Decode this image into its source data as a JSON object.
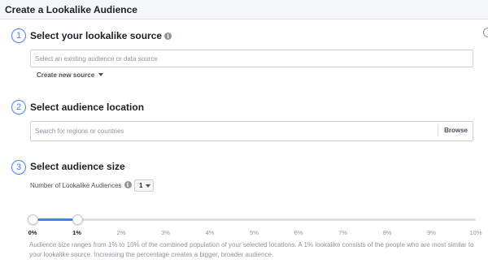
{
  "header": {
    "title": "Create a Lookalike Audience"
  },
  "steps": [
    {
      "number": "1",
      "title": "Select your lookalike source",
      "info_icon": "info-icon",
      "input_placeholder": "Select an existing audience or data source",
      "create_source_label": "Create new source"
    },
    {
      "number": "2",
      "title": "Select audience location",
      "input_placeholder": "Search for regions or countries",
      "browse_label": "Browse"
    },
    {
      "number": "3",
      "title": "Select audience size",
      "num_label": "Number of Lookalike Audiences",
      "num_value": "1"
    }
  ],
  "slider": {
    "range_percent": [
      0,
      1
    ],
    "ticks": [
      "0%",
      "1%",
      "2%",
      "3%",
      "4%",
      "5%",
      "6%",
      "7%",
      "8%",
      "9%",
      "10%"
    ],
    "active_ticks": [
      0,
      1
    ]
  },
  "description": "Audience size ranges from 1% to 10% of the combined population of your selected locations. A 1% lookalike consists of the people who are most similar to your lookalike source. Increasing the percentage creates a bigger, broader audience.",
  "colors": {
    "accent": "#4080ff",
    "header_bg": "#f5f6f7",
    "muted_text": "#90949c"
  }
}
